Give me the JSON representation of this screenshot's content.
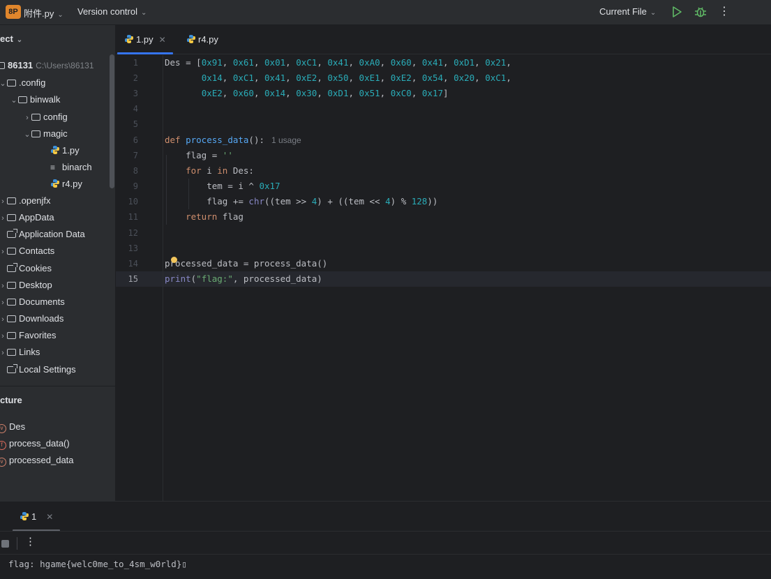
{
  "titlebar": {
    "project_badge": "8P",
    "project_name": "附件.py",
    "vcs_label": "Version control",
    "run_config": "Current File"
  },
  "project_panel": {
    "header": "ect",
    "items": [
      {
        "label": "86131",
        "extra": "C:\\Users\\86131"
      },
      {
        "label": ".config"
      },
      {
        "label": "binwalk"
      },
      {
        "label": "config"
      },
      {
        "label": "magic"
      },
      {
        "label": "1.py"
      },
      {
        "label": "binarch"
      },
      {
        "label": "r4.py"
      },
      {
        "label": ".openjfx"
      },
      {
        "label": "AppData"
      },
      {
        "label": "Application Data"
      },
      {
        "label": "Contacts"
      },
      {
        "label": "Cookies"
      },
      {
        "label": "Desktop"
      },
      {
        "label": "Documents"
      },
      {
        "label": "Downloads"
      },
      {
        "label": "Favorites"
      },
      {
        "label": "Links"
      },
      {
        "label": "Local Settings"
      }
    ]
  },
  "structure_panel": {
    "header": "cture",
    "items": [
      {
        "badge": "v",
        "label": "Des"
      },
      {
        "badge": "f",
        "label": "process_data()"
      },
      {
        "badge": "v",
        "label": "processed_data"
      }
    ]
  },
  "editor": {
    "tabs": [
      {
        "label": "1.py",
        "active": true
      },
      {
        "label": "r4.py",
        "active": false
      }
    ],
    "line_numbers": [
      "1",
      "2",
      "3",
      "4",
      "5",
      "6",
      "7",
      "8",
      "9",
      "10",
      "11",
      "12",
      "13",
      "14",
      "15"
    ],
    "current_line": "15",
    "usage_hint": "1 usage"
  },
  "run_panel": {
    "tab_label": "1",
    "output": "flag: hgame{welc0me_to_4sm_w0rld}▯"
  },
  "colors": {
    "accent": "#3574f0",
    "keyword": "#cf8e6d",
    "function": "#56a8f5",
    "number": "#2aacb8",
    "string": "#6aab73",
    "badge": "#e0862c"
  }
}
